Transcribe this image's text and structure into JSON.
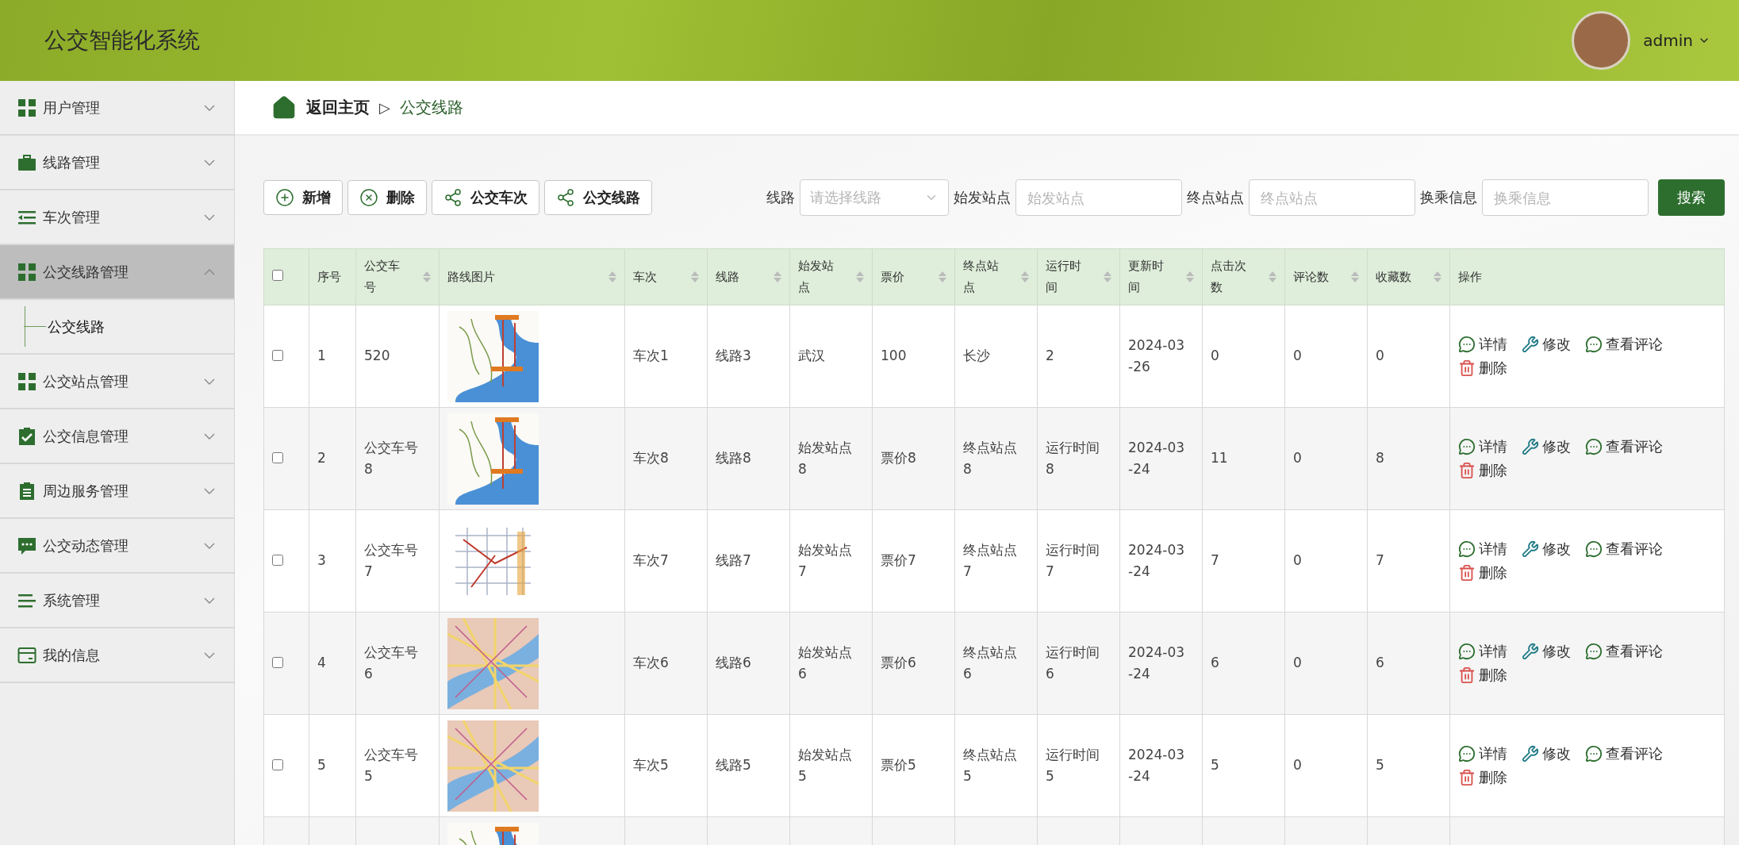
{
  "header": {
    "title": "公交智能化系统",
    "user": "admin"
  },
  "sidebar": {
    "items": [
      {
        "label": "用户管理",
        "expanded": false
      },
      {
        "label": "线路管理",
        "expanded": false
      },
      {
        "label": "车次管理",
        "expanded": false
      },
      {
        "label": "公交线路管理",
        "expanded": true,
        "children": [
          {
            "label": "公交线路"
          }
        ]
      },
      {
        "label": "公交站点管理",
        "expanded": false
      },
      {
        "label": "公交信息管理",
        "expanded": false
      },
      {
        "label": "周边服务管理",
        "expanded": false
      },
      {
        "label": "公交动态管理",
        "expanded": false
      },
      {
        "label": "系统管理",
        "expanded": false
      },
      {
        "label": "我的信息",
        "expanded": false
      }
    ]
  },
  "breadcrumb": {
    "home": "返回主页",
    "separator": "▷",
    "current": "公交线路"
  },
  "toolbar": {
    "buttons": [
      {
        "label": "新增",
        "kind": "add"
      },
      {
        "label": "删除",
        "kind": "delete"
      },
      {
        "label": "公交车次",
        "kind": "share"
      },
      {
        "label": "公交线路",
        "kind": "share"
      }
    ],
    "filters": [
      {
        "label": "线路",
        "placeholder": "请选择线路",
        "kind": "select"
      },
      {
        "label": "始发站点",
        "placeholder": "始发站点",
        "kind": "input"
      },
      {
        "label": "终点站点",
        "placeholder": "终点站点",
        "kind": "input"
      },
      {
        "label": "换乘信息",
        "placeholder": "换乘信息",
        "kind": "input"
      }
    ],
    "search": "搜索"
  },
  "table": {
    "all_checked": false,
    "columns": [
      {
        "label": "序号",
        "sortable": false
      },
      {
        "label": "公交车号",
        "sortable": true
      },
      {
        "label": "路线图片",
        "sortable": true
      },
      {
        "label": "车次",
        "sortable": true
      },
      {
        "label": "线路",
        "sortable": true
      },
      {
        "label": "始发站点",
        "sortable": true
      },
      {
        "label": "票价",
        "sortable": true
      },
      {
        "label": "终点站点",
        "sortable": true
      },
      {
        "label": "运行时间",
        "sortable": true
      },
      {
        "label": "更新时间",
        "sortable": true
      },
      {
        "label": "点击次数",
        "sortable": true
      },
      {
        "label": "评论数",
        "sortable": true
      },
      {
        "label": "收藏数",
        "sortable": true
      },
      {
        "label": "操作",
        "sortable": false
      }
    ],
    "rows": [
      {
        "checked": false,
        "kind": "line-map",
        "cells": [
          "1",
          "520",
          "",
          "车次1",
          "线路3",
          "武汉",
          "100",
          "长沙",
          "2",
          "2024-03-26",
          "0",
          "0",
          "0"
        ],
        "actions": [
          {
            "label": "详情",
            "kind": "detail"
          },
          {
            "label": "修改",
            "kind": "edit"
          },
          {
            "label": "查看评论",
            "kind": "comment"
          },
          {
            "label": "删除",
            "kind": "delete"
          }
        ]
      },
      {
        "checked": false,
        "kind": "line-map",
        "cells": [
          "2",
          "公交车号8",
          "",
          "车次8",
          "线路8",
          "始发站点8",
          "票价8",
          "终点站点8",
          "运行时间8",
          "2024-03-24",
          "11",
          "0",
          "8"
        ],
        "actions": [
          {
            "label": "详情",
            "kind": "detail"
          },
          {
            "label": "修改",
            "kind": "edit"
          },
          {
            "label": "查看评论",
            "kind": "comment"
          },
          {
            "label": "删除",
            "kind": "delete"
          }
        ]
      },
      {
        "checked": false,
        "kind": "street-map",
        "cells": [
          "3",
          "公交车号7",
          "",
          "车次7",
          "线路7",
          "始发站点7",
          "票价7",
          "终点站点7",
          "运行时间7",
          "2024-03-24",
          "7",
          "0",
          "7"
        ],
        "actions": [
          {
            "label": "详情",
            "kind": "detail"
          },
          {
            "label": "修改",
            "kind": "edit"
          },
          {
            "label": "查看评论",
            "kind": "comment"
          },
          {
            "label": "删除",
            "kind": "delete"
          }
        ]
      },
      {
        "checked": false,
        "kind": "city-map",
        "cells": [
          "4",
          "公交车号6",
          "",
          "车次6",
          "线路6",
          "始发站点6",
          "票价6",
          "终点站点6",
          "运行时间6",
          "2024-03-24",
          "6",
          "0",
          "6"
        ],
        "actions": [
          {
            "label": "详情",
            "kind": "detail"
          },
          {
            "label": "修改",
            "kind": "edit"
          },
          {
            "label": "查看评论",
            "kind": "comment"
          },
          {
            "label": "删除",
            "kind": "delete"
          }
        ]
      },
      {
        "checked": false,
        "kind": "city-map",
        "cells": [
          "5",
          "公交车号5",
          "",
          "车次5",
          "线路5",
          "始发站点5",
          "票价5",
          "终点站点5",
          "运行时间5",
          "2024-03-24",
          "5",
          "0",
          "5"
        ],
        "actions": [
          {
            "label": "详情",
            "kind": "detail"
          },
          {
            "label": "修改",
            "kind": "edit"
          },
          {
            "label": "查看评论",
            "kind": "comment"
          },
          {
            "label": "删除",
            "kind": "delete"
          }
        ]
      }
    ],
    "partial_row": {
      "kind": "line-map"
    }
  }
}
